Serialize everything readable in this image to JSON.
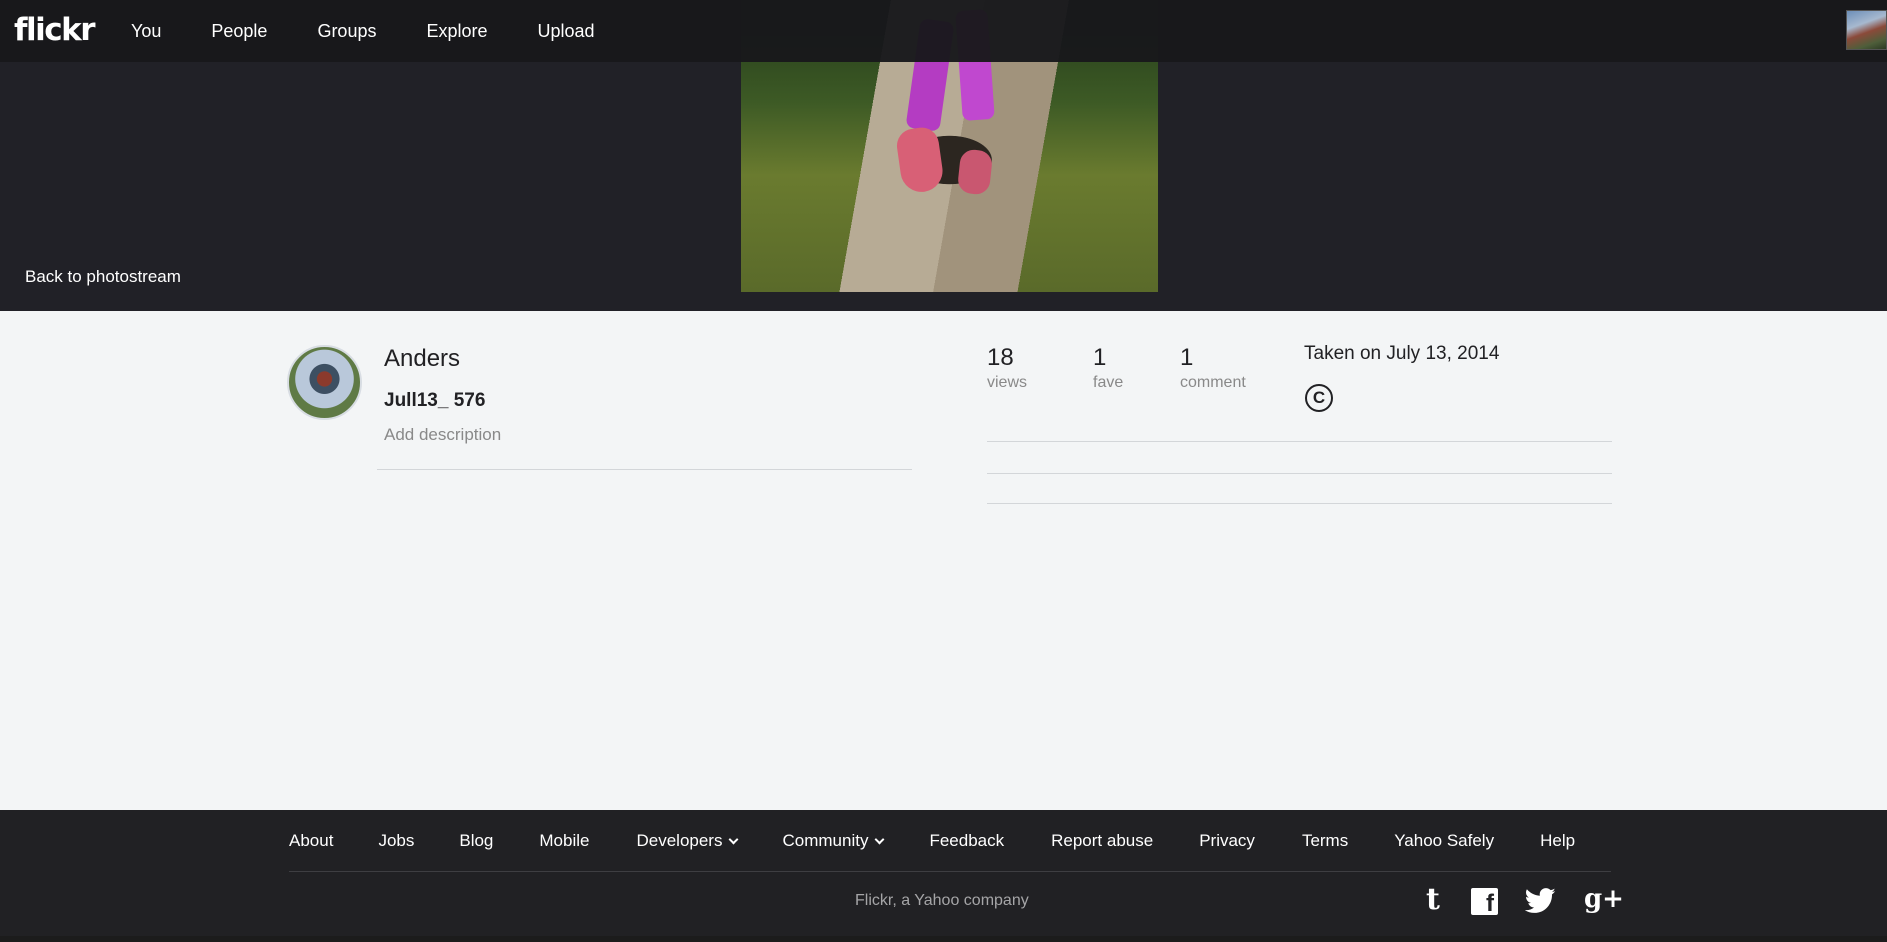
{
  "brand": {
    "logo": "flickr"
  },
  "nav": {
    "you": "You",
    "people": "People",
    "groups": "Groups",
    "explore": "Explore",
    "upload": "Upload"
  },
  "hero": {
    "back_link": "Back to photostream"
  },
  "owner": {
    "name": "Anders"
  },
  "photo": {
    "title": "Jull13_ 576",
    "add_description": "Add description",
    "taken": "Taken on July 13, 2014"
  },
  "stats": {
    "views": {
      "count": "18",
      "label": "views"
    },
    "faves": {
      "count": "1",
      "label": "fave"
    },
    "comments": {
      "count": "1",
      "label": "comment"
    }
  },
  "license": {
    "symbol": "C"
  },
  "footer": {
    "links": {
      "about": "About",
      "jobs": "Jobs",
      "blog": "Blog",
      "mobile": "Mobile",
      "developers": "Developers",
      "community": "Community",
      "feedback": "Feedback",
      "report_abuse": "Report abuse",
      "privacy": "Privacy",
      "terms": "Terms",
      "yahoo_safely": "Yahoo Safely",
      "help": "Help"
    },
    "company": "Flickr, a Yahoo company",
    "social": {
      "tumblr": "t",
      "facebook": "f",
      "twitter": "twitter",
      "googleplus": "g+"
    }
  },
  "icons": {
    "tumblr": "tumblr-icon",
    "facebook": "facebook-icon",
    "twitter": "twitter-icon",
    "googleplus": "googleplus-icon",
    "copyright": "copyright-icon"
  }
}
